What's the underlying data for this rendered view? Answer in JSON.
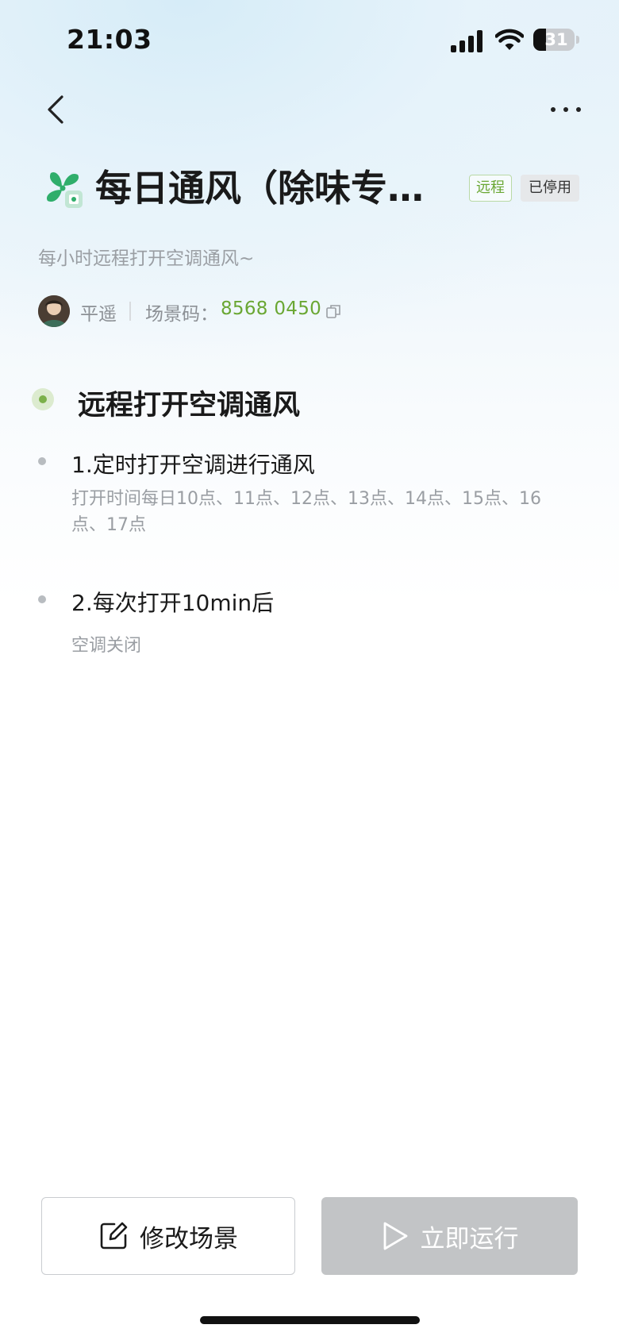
{
  "status_bar": {
    "time": "21:03",
    "battery": "31",
    "icons": [
      "signal-icon",
      "wifi-icon",
      "battery-icon"
    ]
  },
  "nav": {
    "back_icon": "chevron-left-icon",
    "more_icon": "more-horizontal-icon"
  },
  "scene": {
    "icon": "fan-icon",
    "title": "每日通风（除味专…",
    "tag_remote": "远程",
    "tag_status": "已停用",
    "description": "每小时远程打开空调通风~",
    "author": "平遥",
    "code_label": "场景码：",
    "code_value": "8568 0450"
  },
  "steps": {
    "group_title": "远程打开空调通风",
    "items": [
      {
        "title": "1.定时打开空调进行通风",
        "detail_line1": "打开时间每日10点、11点、12点、13点、14点、15点、16",
        "detail_line2": "点、17点"
      },
      {
        "title": "2.每次打开10min后",
        "detail_line1": "空调关闭"
      }
    ]
  },
  "actions": {
    "edit_label": "修改场景",
    "run_label": "立即运行",
    "edit_icon": "edit-icon",
    "run_icon": "play-icon"
  },
  "colors": {
    "accent_green": "#6aa733",
    "disabled_button": "#c2c4c6",
    "secondary_text": "#9a9ea3"
  }
}
